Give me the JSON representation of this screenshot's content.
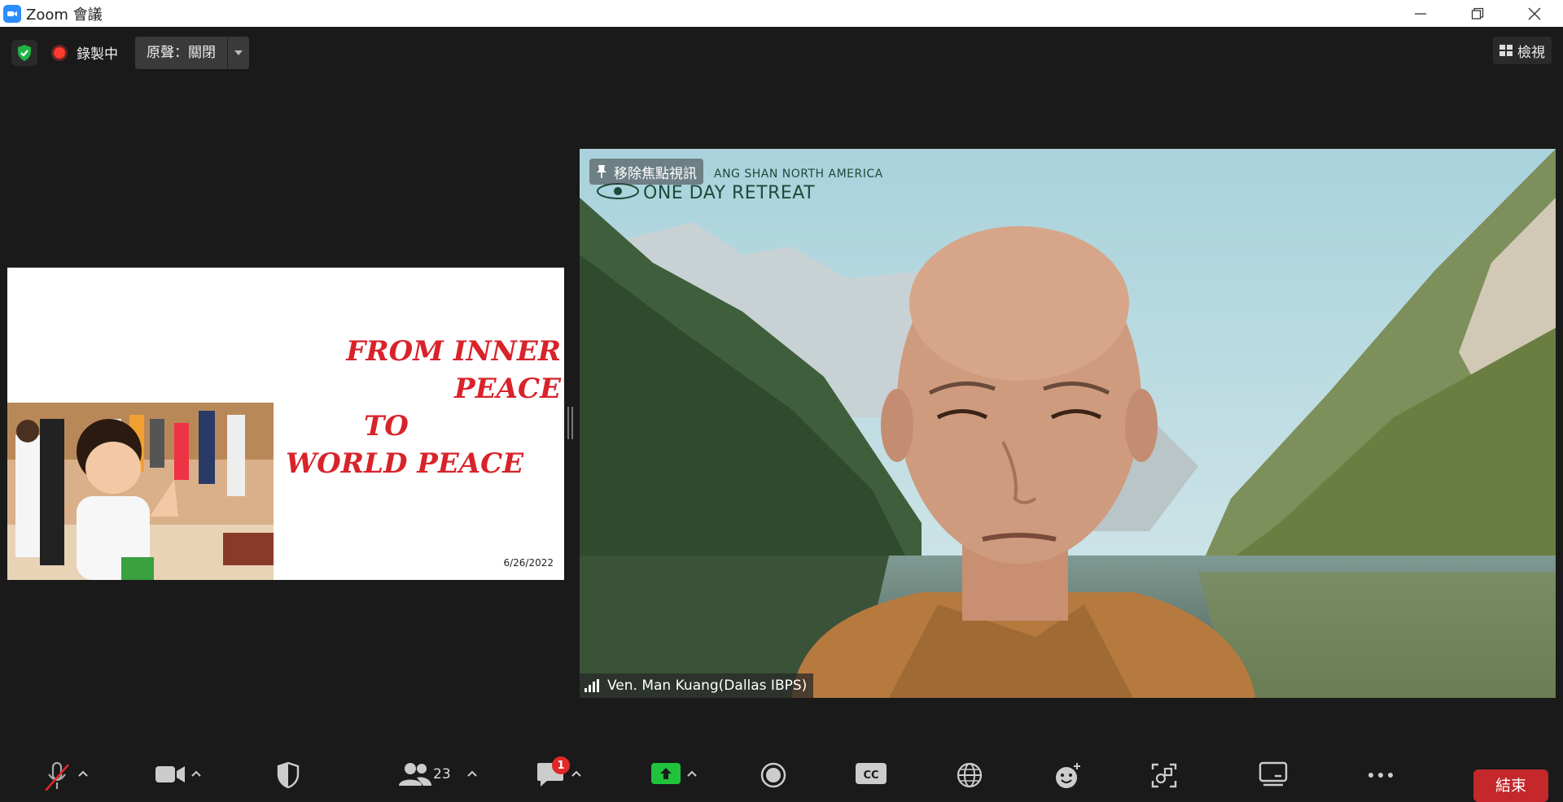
{
  "window": {
    "title": "Zoom 會議",
    "app_icon": "zoom-camera-icon",
    "controls": [
      "minimize-icon",
      "restore-icon",
      "close-icon"
    ]
  },
  "topbar": {
    "security_icon": "shield-check-icon",
    "recording_label": "錄製中",
    "audio_label": "原聲：關閉",
    "view_label": "檢視"
  },
  "slide": {
    "title_lines": [
      "FROM INNER PEACE",
      "TO",
      "WORLD PEACE"
    ],
    "date": "6/26/2022",
    "title_color": "#d8232a"
  },
  "video": {
    "unpin_label": "移除焦點視訊",
    "bg_caption_small": "ANG SHAN NORTH AMERICA",
    "bg_caption_large": "ONE DAY RETREAT",
    "participant_name": "Ven. Man Kuang(Dallas IBPS)"
  },
  "toolbar": {
    "participants_count": "23",
    "chat_unread": "1",
    "end_label": "結束",
    "accent_green": "#20c33b",
    "end_color": "#c4282b"
  }
}
